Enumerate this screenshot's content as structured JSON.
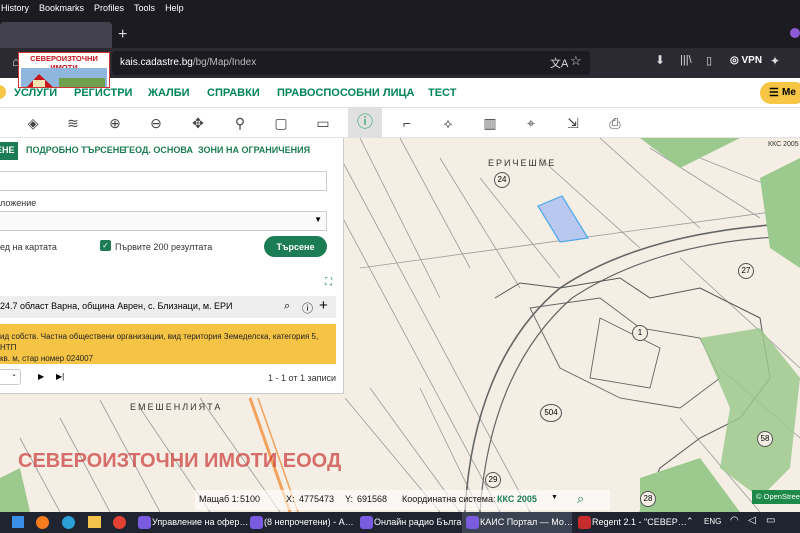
{
  "menubar": {
    "items": [
      "History",
      "Bookmarks",
      "Profiles",
      "Tools",
      "Help"
    ]
  },
  "browser": {
    "url_domain": "kais.cadastre.bg",
    "url_path": "/bg/Map/Index",
    "vpn_label": "VPN",
    "new_tab": "+"
  },
  "logo": {
    "text": "СЕВЕРОИЗТОЧНИ ИМОТИ"
  },
  "nav": {
    "items": [
      "УСЛУГИ",
      "РЕГИСТРИ",
      "ЖАЛБИ",
      "СПРАВКИ",
      "ПРАВОСПОСОБНИ ЛИЦА",
      "ТЕСТ"
    ],
    "menu_label": "Ме"
  },
  "panel": {
    "tabs": [
      "ЕНЕ",
      "ПОДРОБНО ТЪРСЕНЕ",
      "ГЕОД. ОСНОВА",
      "ЗОНИ НА ОГРАНИЧЕНИЯ"
    ],
    "location_label": "ложение",
    "on_map_label": "ед на картата",
    "first200_label": "Първите 200 резултата",
    "search_button": "Търсене",
    "result_text": "24.7 област Варна, община Аврен, с. Близнаци, м. ЕРИ",
    "detail_line1": "ид собств. Частна обществени организации, вид територия Земеделска, категория 5, НТП",
    "detail_line2": "кв. м, стар номер 024007",
    "pager_text": "1 - 1 от 1 записи"
  },
  "map": {
    "labels": {
      "erichesme": "ЕРИЧЕШМЕ",
      "emeshenliyata": "ЕМЕШЕНЛИЯТА",
      "kks": "ККС 2005",
      "watermark": "СЕВЕРОИЗТОЧНИ ИМОТИ ЕООД",
      "osm": "© OpenStreetMap"
    },
    "parcels": [
      "24",
      "27",
      "1",
      "504",
      "58",
      "29",
      "28"
    ]
  },
  "status": {
    "scale_label": "Мащаб 1:",
    "scale_value": "5100",
    "x_label": "X:",
    "x_value": "4775473",
    "y_label": "Y:",
    "y_value": "691568",
    "coord_label": "Координатна система:",
    "coord_value": "ККС 2005"
  },
  "taskbar": {
    "items": [
      "Управление на офер…",
      "(8 непрочетени) - А…",
      "Онлайн радио Бълга…",
      "КАИС Портал — Мо…",
      "Regent 2.1 - \"СЕВЕР…"
    ],
    "lang": "ENG"
  },
  "colors": {
    "accent": "#008556",
    "highlight": "#f5c445",
    "selected_parcel": "#b9c8ef"
  }
}
